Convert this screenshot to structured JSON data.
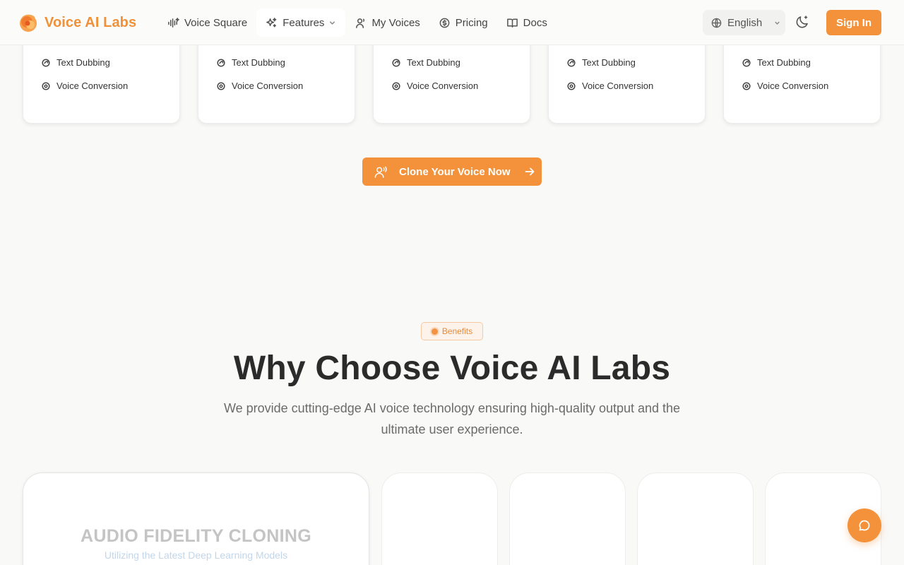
{
  "header": {
    "brand": "Voice AI Labs",
    "nav": [
      {
        "label": "Voice Square",
        "icon": "waveform-icon"
      },
      {
        "label": "Features",
        "icon": "sparkles-icon"
      },
      {
        "label": "My Voices",
        "icon": "user-voice-icon"
      },
      {
        "label": "Pricing",
        "icon": "coin-icon"
      },
      {
        "label": "Docs",
        "icon": "book-icon"
      }
    ],
    "language": "English",
    "sign_in": "Sign In"
  },
  "voice_cards": [
    {
      "features": [
        "Text Dubbing",
        "Voice Conversion"
      ]
    },
    {
      "features": [
        "Text Dubbing",
        "Voice Conversion"
      ]
    },
    {
      "features": [
        "Text Dubbing",
        "Voice Conversion"
      ]
    },
    {
      "features": [
        "Text Dubbing",
        "Voice Conversion"
      ]
    },
    {
      "features": [
        "Text Dubbing",
        "Voice Conversion"
      ]
    }
  ],
  "cta": {
    "label": "Clone Your Voice Now"
  },
  "benefits": {
    "badge": "Benefits",
    "title": "Why Choose Voice AI Labs",
    "subtitle": "We provide cutting-edge AI voice technology ensuring high-quality output and the ultimate user experience."
  },
  "feature_cards": [
    {
      "title": "AUDIO FIDELITY CLONING",
      "subtitle": "Utilizing the Latest Deep Learning Models"
    }
  ],
  "colors": {
    "accent": "#f3923b",
    "heading": "#2b2b2b",
    "muted": "#6b6b6b"
  }
}
